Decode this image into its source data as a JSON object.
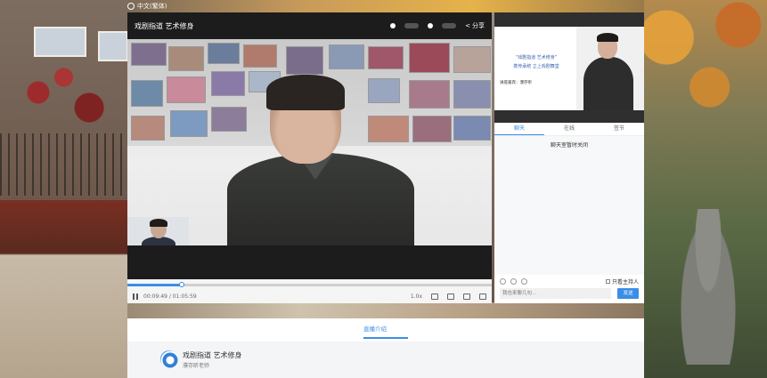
{
  "topbar": {
    "language": "中文(繁体)"
  },
  "player": {
    "title": "戏剧指道 艺术修身",
    "share_label": "分享",
    "current_time": "00:09:49",
    "duration": "01:05:59",
    "progress": 0.15,
    "speed": "1.0x"
  },
  "slide": {
    "line1": "“戏剧指道 艺术修身”",
    "line2": "携传承统 立上戏剧舞堂",
    "sub": "讲座嘉宾：濮存昕"
  },
  "chat": {
    "tabs": [
      "聊天",
      "在线",
      "签节"
    ],
    "active_tab": 0,
    "notice": "聊天室暂时关闭",
    "host_only_label": "只看主持人",
    "input_placeholder": "我也来聊几句…",
    "send_label": "发送"
  },
  "intro": {
    "tab_label": "直播介绍",
    "course_title": "戏剧指道 艺术修身",
    "teacher": "濮存昕老师"
  },
  "icons": [
    "globe-icon",
    "share-icon",
    "pause-icon",
    "volume-icon",
    "fullscreen-icon",
    "emoji-icon"
  ],
  "colors": {
    "accent": "#3a8ee6",
    "player_bg": "#1c1c1c"
  }
}
